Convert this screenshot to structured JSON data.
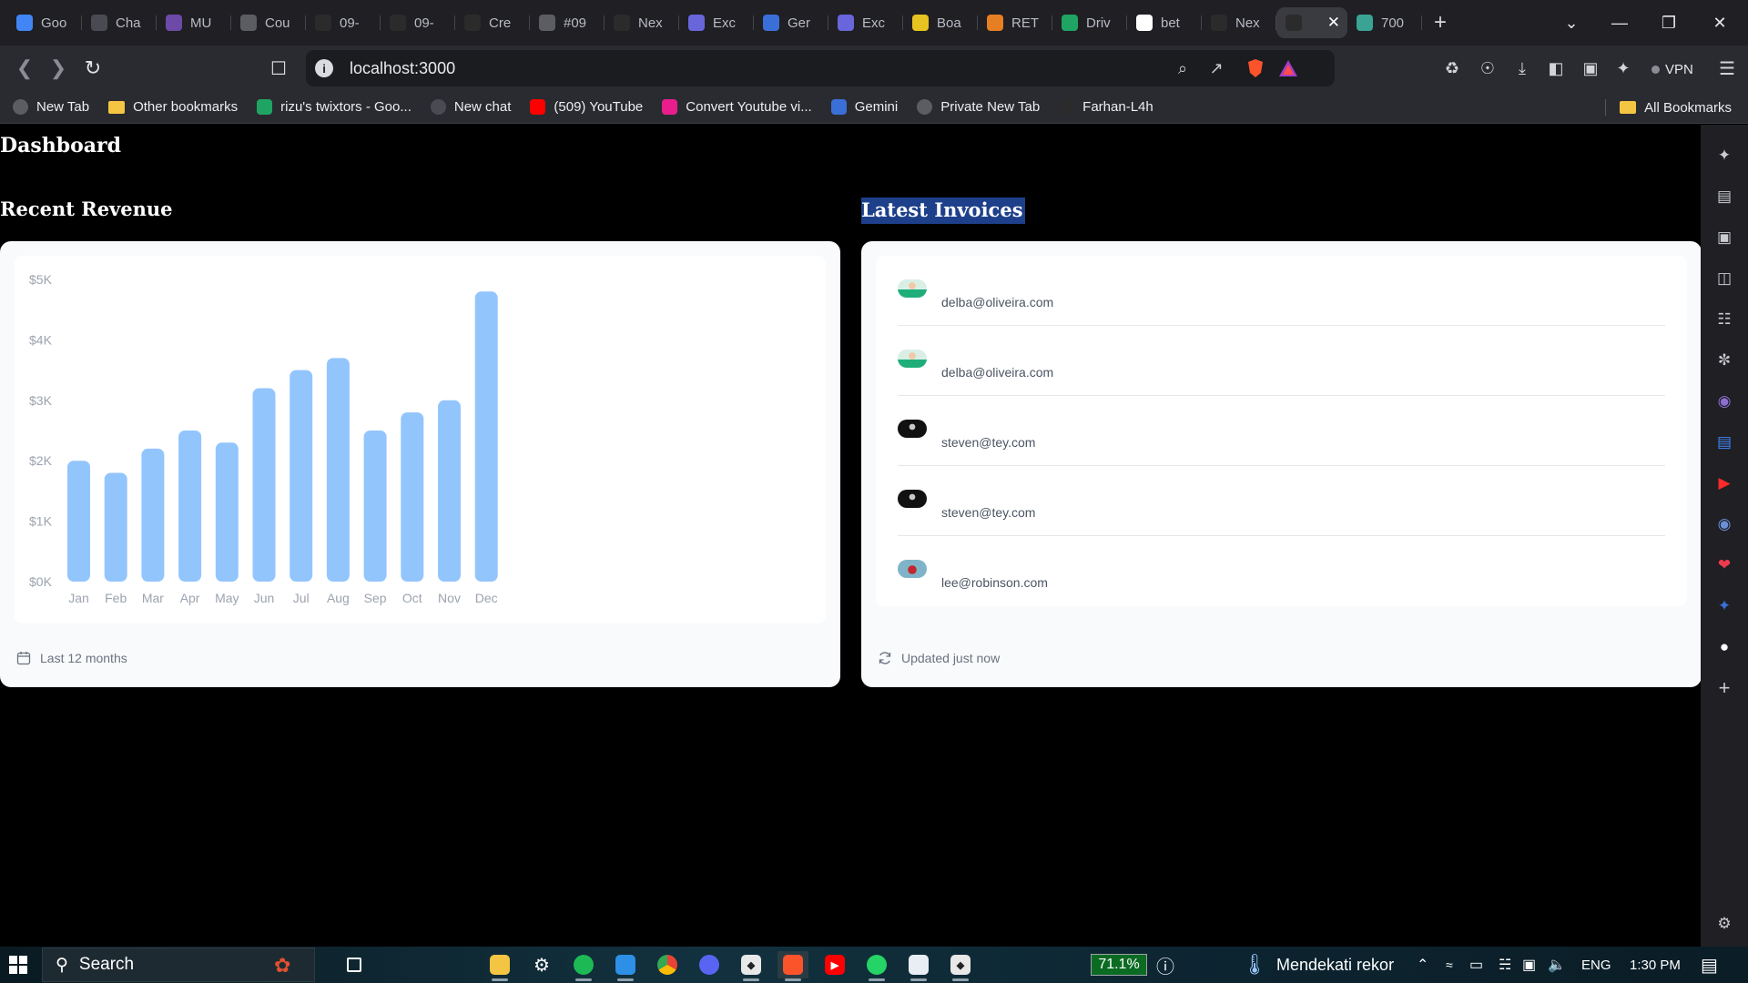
{
  "browser": {
    "tabs": [
      {
        "title": "Goo",
        "icon": "docs-icon",
        "color": "#4285f4"
      },
      {
        "title": "Cha",
        "icon": "openai-icon",
        "color": "#4a4b52"
      },
      {
        "title": "MU",
        "icon": "crest-icon",
        "color": "#6d4aa8"
      },
      {
        "title": "Cou",
        "icon": "course-icon",
        "color": "#5b5d63"
      },
      {
        "title": "09-",
        "icon": "github-icon",
        "color": "#2b2b2b"
      },
      {
        "title": "09-",
        "icon": "vercel-icon",
        "color": "#2b2b2b"
      },
      {
        "title": "Cre",
        "icon": "vercel-icon",
        "color": "#2b2b2b"
      },
      {
        "title": "#09",
        "icon": "globe-icon",
        "color": "#5b5d63"
      },
      {
        "title": "Nex",
        "icon": "medium-icon",
        "color": "#2b2b2b"
      },
      {
        "title": "Exc",
        "icon": "excalidraw-icon",
        "color": "#6965db"
      },
      {
        "title": "Ger",
        "icon": "gemini-icon",
        "color": "#3b6fd8"
      },
      {
        "title": "Exc",
        "icon": "excalidraw-icon",
        "color": "#6965db"
      },
      {
        "title": "Boa",
        "icon": "miro-icon",
        "color": "#e6c320"
      },
      {
        "title": "RET",
        "icon": "retool-icon",
        "color": "#e67e22"
      },
      {
        "title": "Driv",
        "icon": "drive-icon",
        "color": "#1fa463"
      },
      {
        "title": "bet",
        "icon": "google-icon",
        "color": "#ffffff"
      },
      {
        "title": "Nex",
        "icon": "medium-icon",
        "color": "#2b2b2b"
      },
      {
        "title": "",
        "icon": "vercel-icon",
        "color": "#2b2b2b",
        "active": true
      },
      {
        "title": "700",
        "icon": "page-icon",
        "color": "#3aa394"
      }
    ],
    "new_tab_label": "+",
    "url": "localhost:3000",
    "vpn_label": "VPN",
    "bookmarks": [
      {
        "label": "New Tab",
        "icon": "globe-icon",
        "color": "#5b5d63"
      },
      {
        "label": "Other bookmarks",
        "icon": "folder-icon",
        "color": "#f4c542"
      },
      {
        "label": "rizu's twixtors - Goo...",
        "icon": "drive-icon",
        "color": "#1fa463"
      },
      {
        "label": "New chat",
        "icon": "openai-icon",
        "color": "#4a4b52"
      },
      {
        "label": "(509) YouTube",
        "icon": "youtube-icon",
        "color": "#ff0000"
      },
      {
        "label": "Convert Youtube vi...",
        "icon": "converter-icon",
        "color": "#e91e8c"
      },
      {
        "label": "Gemini",
        "icon": "gemini-icon",
        "color": "#3b6fd8"
      },
      {
        "label": "Private New Tab",
        "icon": "globe-icon",
        "color": "#5b5d63"
      },
      {
        "label": "Farhan-L4h",
        "icon": "github-icon",
        "color": "#2b2b2b"
      }
    ],
    "all_bookmarks_label": "All Bookmarks"
  },
  "dashboard": {
    "title": "Dashboard",
    "revenue": {
      "heading": "Recent Revenue",
      "footer": "Last 12 months"
    },
    "invoices": {
      "heading": "Latest Invoices",
      "footer": "Updated just now",
      "items": [
        {
          "email": "delba@oliveira.com",
          "avatar": "avatar-green"
        },
        {
          "email": "delba@oliveira.com",
          "avatar": "avatar-green"
        },
        {
          "email": "steven@tey.com",
          "avatar": "avatar-dark"
        },
        {
          "email": "steven@tey.com",
          "avatar": "avatar-dark"
        },
        {
          "email": "lee@robinson.com",
          "avatar": "avatar-blue"
        }
      ]
    }
  },
  "chart_data": {
    "type": "bar",
    "categories": [
      "Jan",
      "Feb",
      "Mar",
      "Apr",
      "May",
      "Jun",
      "Jul",
      "Aug",
      "Sep",
      "Oct",
      "Nov",
      "Dec"
    ],
    "values": [
      2000,
      1800,
      2200,
      2500,
      2300,
      3200,
      3500,
      3700,
      2500,
      2800,
      3000,
      4800
    ],
    "y_ticks": [
      "$0K",
      "$1K",
      "$2K",
      "$3K",
      "$4K",
      "$5K"
    ],
    "ylim": [
      0,
      5000
    ],
    "color": "#93c5fd"
  },
  "taskbar": {
    "search_label": "Search",
    "battery_label": "71.1%",
    "weather_label": "Mendekati rekor",
    "language_label": "ENG",
    "time_label": "1:30 PM"
  }
}
